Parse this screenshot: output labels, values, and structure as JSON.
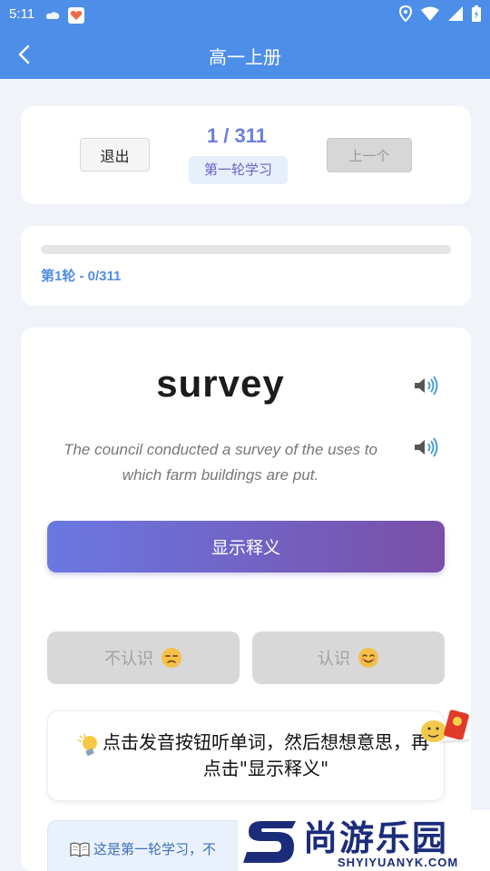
{
  "status_bar": {
    "time": "5:11"
  },
  "app_bar": {
    "title": "高一上册"
  },
  "navigation": {
    "exit_label": "退出",
    "counter": "1 / 311",
    "round_label": "第一轮学习",
    "prev_label": "上一个"
  },
  "progress": {
    "text": "第1轮 - 0/311",
    "fraction": 0
  },
  "word_card": {
    "word": "survey",
    "example_sentence": "The council conducted a survey of the uses to which farm buildings are put.",
    "show_meaning_label": "显示释义",
    "unknown_label": "不认识",
    "known_label": "认识",
    "tip_text": "点击发音按钮听单词，然后想想意思，再点击\"显示释义\"",
    "note_text": "这是第一轮学习，不"
  },
  "watermark": {
    "title": "尚游乐园",
    "url": "SHYIYUANYK.COM"
  },
  "colors": {
    "app_bar": "#4d8ee8",
    "accent": "#6a7fe0",
    "button_gradient_start": "#6a78e2",
    "button_gradient_end": "#7a4fa8"
  }
}
